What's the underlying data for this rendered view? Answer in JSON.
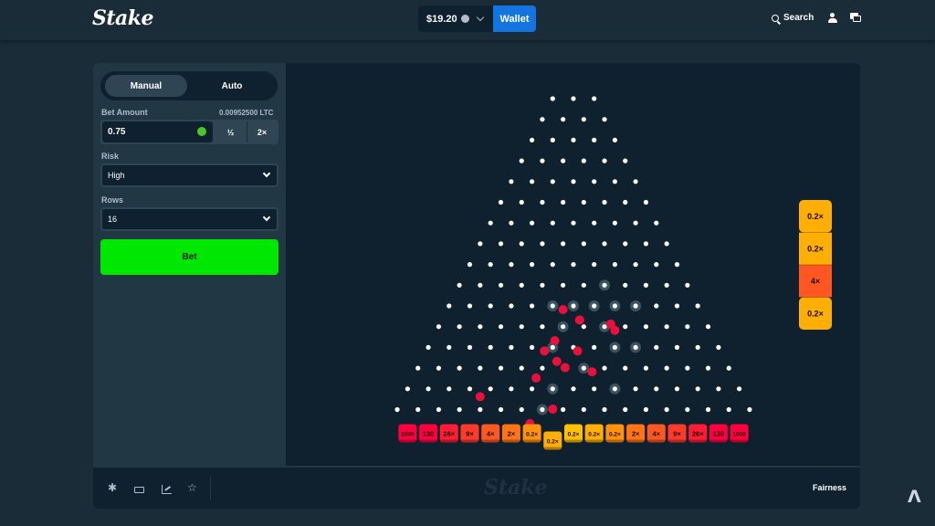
{
  "header": {
    "logo": "Stake",
    "balance": "$19.20",
    "wallet_label": "Wallet",
    "search_label": "Search"
  },
  "controls": {
    "tabs": [
      "Manual",
      "Auto"
    ],
    "active_tab": "Manual",
    "bet_amount_label": "Bet Amount",
    "bet_amount_crypto": "0.00952500 LTC",
    "bet_amount_value": "0.75",
    "half_label": "½",
    "double_label": "2×",
    "risk_label": "Risk",
    "risk_value": "High",
    "rows_label": "Rows",
    "rows_value": "16",
    "bet_button": "Bet"
  },
  "board": {
    "rows": 16,
    "multipliers": [
      "1000",
      "130",
      "26×",
      "9×",
      "4×",
      "2×",
      "0.2×",
      "0.2×",
      "0.2×",
      "0.2×",
      "0.2×",
      "2×",
      "4×",
      "9×",
      "26×",
      "130",
      "1000"
    ],
    "dropped_bucket_index": 7,
    "bucket_colors": [
      "#ff003f",
      "#ff003f",
      "#ff1d35",
      "#ff3a2b",
      "#ff5721",
      "#ff7417",
      "#ff910d",
      "#ffae03",
      "#ffc000",
      "#ffae03",
      "#ff910d",
      "#ff7417",
      "#ff5721",
      "#ff3a2b",
      "#ff1d35",
      "#ff003f",
      "#ff003f"
    ],
    "ball_color": "#e9113c",
    "balls": [
      {
        "row": 10,
        "slot": 5.5
      },
      {
        "row": 10.5,
        "slot": 6.3
      },
      {
        "row": 10.7,
        "slot": 7.8
      },
      {
        "row": 11,
        "slot": 8.5
      },
      {
        "row": 11.5,
        "slot": 5.6
      },
      {
        "row": 12,
        "slot": 5.6
      },
      {
        "row": 12,
        "slot": 7.2
      },
      {
        "row": 12.5,
        "slot": 6.2
      },
      {
        "row": 12.8,
        "slot": 6.6
      },
      {
        "row": 13,
        "slot": 8.4
      },
      {
        "row": 13.3,
        "slot": 5.7
      },
      {
        "row": 14.2,
        "slot": 3.5
      },
      {
        "row": 14.8,
        "slot": 7.0
      },
      {
        "row": 15.5,
        "slot": 6.4
      }
    ],
    "highlighted_pegs": [
      {
        "row": 10,
        "col": 5
      },
      {
        "row": 10,
        "col": 6
      },
      {
        "row": 10,
        "col": 7
      },
      {
        "row": 10,
        "col": 8
      },
      {
        "row": 10,
        "col": 9
      },
      {
        "row": 11,
        "col": 6
      },
      {
        "row": 11,
        "col": 8
      },
      {
        "row": 12,
        "col": 6
      },
      {
        "row": 12,
        "col": 9
      },
      {
        "row": 12,
        "col": 10
      },
      {
        "row": 13,
        "col": 8
      },
      {
        "row": 14,
        "col": 7
      },
      {
        "row": 14,
        "col": 10
      },
      {
        "row": 15,
        "col": 7
      },
      {
        "row": 9,
        "col": 7
      }
    ]
  },
  "recent_results": [
    "0.2×",
    "0.2×",
    "4×",
    "0.2×"
  ],
  "recent_colors": [
    "#ffae03",
    "#ffae03",
    "#ff5721",
    "#ffae03"
  ],
  "footer": {
    "watermark": "Stake",
    "fairness_label": "Fairness"
  }
}
